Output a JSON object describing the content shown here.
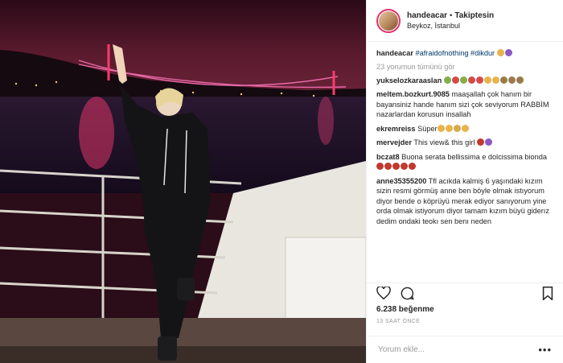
{
  "post": {
    "username": "handeacar",
    "dot": "•",
    "follow_status": "Takiptesin",
    "location": "Beykoz, İstanbul"
  },
  "caption": {
    "user": "handeacar",
    "hashtags": "#afraidofnothing #dikdur"
  },
  "view_all": "23 yorumun tümünü gör",
  "comments": [
    {
      "user": "yukselozkaraaslan",
      "text": ""
    },
    {
      "user": "meltem.bozkurt.9085",
      "text": "maaşallah çok hanım bir bayansiniz hande hanım sizi çok seviyorum RABBİM nazarlardan korusun insallah"
    },
    {
      "user": "ekremreiss",
      "text": "Süper"
    },
    {
      "user": "mervejder",
      "text": "This view& this girl"
    },
    {
      "user": "bczat8",
      "text": "Buona serata bellissima e dolcissima bionda"
    },
    {
      "user": "anne35355200",
      "text": "Tfl acıkda kalmiş 6 yaşındaki kızım sizin resmi görmüş anne ben böyle olmak istıyorum diyor bende o köprüyü merak ediyor sanıyorum yine orda olmak istiyorum diyor tamam kızım büyü giderız dedim ondaki teokı sen benı neden"
    }
  ],
  "likes": "6.238 beğenme",
  "time": "13 SAAT ÖNCE",
  "add_comment_placeholder": "Yorum ekle...",
  "more": "•••",
  "icons": {
    "like": "heart-icon",
    "comment": "comment-icon",
    "bookmark": "bookmark-icon"
  },
  "colors": {
    "bridge_lights": "#e05a9c",
    "night_sky": "#3a1020",
    "hashtag": "#003569"
  }
}
